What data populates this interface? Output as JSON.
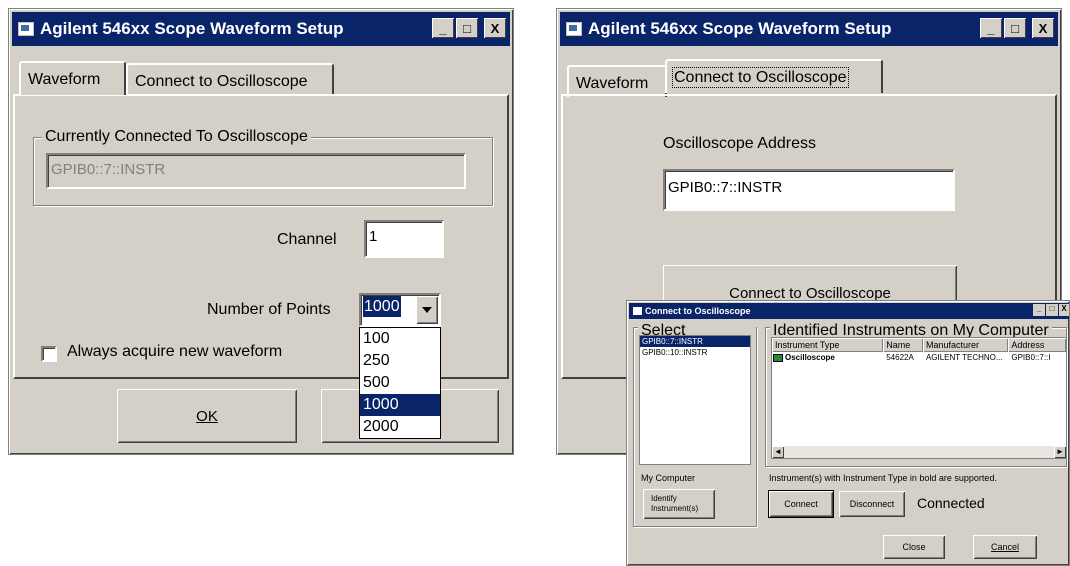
{
  "left_dialog": {
    "title": "Agilent 546xx Scope Waveform Setup",
    "title_buttons": [
      "_",
      "□",
      "X"
    ],
    "tabs": [
      {
        "label": "Waveform",
        "active": true
      },
      {
        "label": "Connect to Oscilloscope",
        "active": false
      }
    ],
    "group_title": "Currently Connected To Oscilloscope",
    "connected_value": "GPIB0::7::INSTR",
    "channel_label": "Channel",
    "channel_value": "1",
    "points_label": "Number of Points",
    "points_value": "1000",
    "points_options": [
      "100",
      "250",
      "500",
      "1000",
      "2000"
    ],
    "points_selected": "1000",
    "checkbox_label": "Always acquire new waveform",
    "checkbox_checked": false,
    "ok_label": "OK"
  },
  "right_dialog": {
    "title": "Agilent 546xx Scope Waveform Setup",
    "title_buttons": [
      "_",
      "□",
      "X"
    ],
    "tabs": [
      {
        "label": "Waveform",
        "active": false
      },
      {
        "label": "Connect to Oscilloscope",
        "active": true
      }
    ],
    "address_label": "Oscilloscope Address",
    "address_value": "GPIB0::7::INSTR",
    "connect_button": "Connect to Oscilloscope"
  },
  "connect_dialog": {
    "title": "Connect to Oscilloscope",
    "title_buttons": [
      "_",
      "□",
      "X"
    ],
    "select_group": "Select Address(es)",
    "addresses": [
      {
        "label": "GPIB0::7::INSTR",
        "selected": true
      },
      {
        "label": "GPIB0::10::INSTR",
        "selected": false
      }
    ],
    "instruments_group": "Identified Instruments on My Computer",
    "columns": [
      "Instrument Type",
      "Name",
      "Manufacturer",
      "Address"
    ],
    "rows": [
      {
        "type": "Oscilloscope",
        "name": "54622A",
        "manufacturer": "AGILENT TECHNO...",
        "address": "GPIB0::7::I"
      }
    ],
    "note": "Instrument(s) with Instrument Type in bold are supported.",
    "my_computer_label": "My Computer",
    "identify_button": "Identify Instrument(s)",
    "connect_button": "Connect",
    "disconnect_button": "Disconnect",
    "status": "Connected",
    "close_button": "Close",
    "cancel_button": "Cancel"
  }
}
